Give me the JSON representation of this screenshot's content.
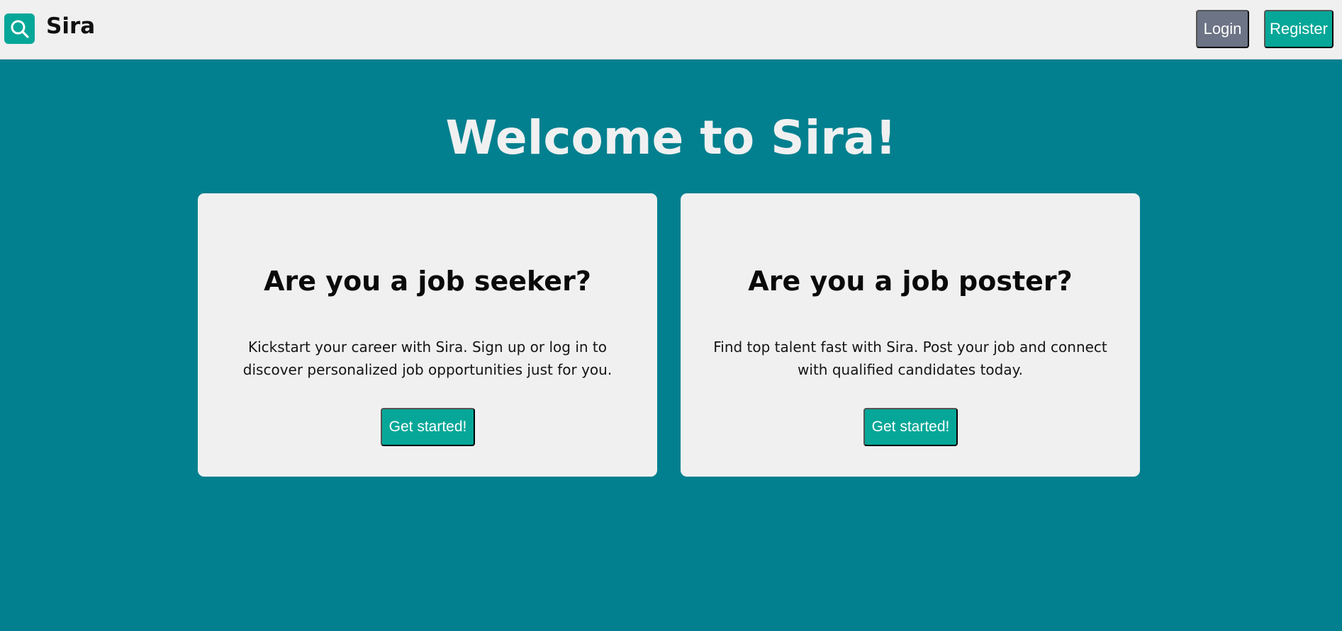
{
  "header": {
    "logo_icon": "search-icon",
    "brand": "Sira",
    "login_label": "Login",
    "register_label": "Register"
  },
  "hero": {
    "title": "Welcome to Sira!"
  },
  "cards": [
    {
      "title": "Are you a job seeker?",
      "description": "Kickstart your career with Sira. Sign up or log in to discover personalized job opportunities just for you.",
      "button_label": "Get started!"
    },
    {
      "title": "Are you a job poster?",
      "description": "Find top talent fast with Sira. Post your job and connect with qualified candidates today.",
      "button_label": "Get started!"
    }
  ],
  "colors": {
    "page_background": "#02808f",
    "header_background": "#f0f0f1",
    "accent": "#06a798",
    "login_button": "#6c7485",
    "card_background": "#f0f0f1"
  }
}
